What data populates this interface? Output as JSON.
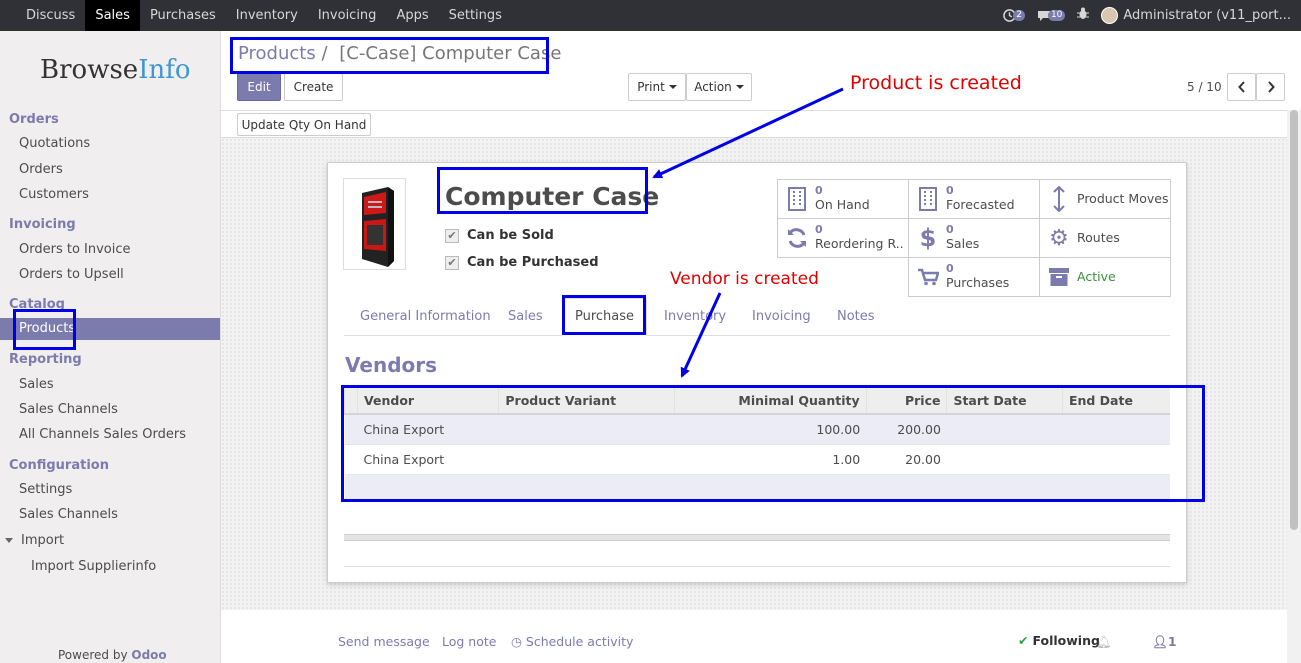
{
  "topbar": {
    "menu": [
      "Discuss",
      "Sales",
      "Purchases",
      "Inventory",
      "Invoicing",
      "Apps",
      "Settings"
    ],
    "active": "Sales",
    "conversation_count": "2",
    "activity_count": "10",
    "user": "Administrator (v11_port..."
  },
  "sidebar": {
    "logo_browse": "Browse",
    "logo_info": "Info",
    "sections": [
      {
        "title": "Orders",
        "items": [
          "Quotations",
          "Orders",
          "Customers"
        ]
      },
      {
        "title": "Invoicing",
        "items": [
          "Orders to Invoice",
          "Orders to Upsell"
        ]
      },
      {
        "title": "Catalog",
        "items": [
          "Products"
        ]
      },
      {
        "title": "Reporting",
        "items": [
          "Sales",
          "Sales Channels",
          "All Channels Sales Orders"
        ]
      },
      {
        "title": "Configuration",
        "items": [
          "Settings",
          "Sales Channels",
          "Import",
          "Import Supplierinfo"
        ]
      }
    ],
    "powered_by": "Powered by",
    "powered_brand": "Odoo"
  },
  "breadcrumb": {
    "parent": "Products",
    "separator": "/",
    "current": "[C-Case] Computer Case"
  },
  "buttons": {
    "edit": "Edit",
    "create": "Create",
    "print": "Print",
    "action": "Action",
    "update_qty": "Update Qty On Hand"
  },
  "pager": {
    "value": "5 / 10"
  },
  "product": {
    "name": "Computer Case",
    "can_be_sold": "Can be Sold",
    "can_be_purchased": "Can be Purchased"
  },
  "smart_buttons": [
    {
      "value": "0",
      "label": "On Hand",
      "icon": "building-icon"
    },
    {
      "value": "0",
      "label": "Forecasted",
      "icon": "building-icon"
    },
    {
      "value": "",
      "label": "Product Moves",
      "icon": "arrows-vertical-icon"
    },
    {
      "value": "0",
      "label": "Reordering R...",
      "icon": "refresh-icon"
    },
    {
      "value": "0",
      "label": "Sales",
      "icon": "dollar-icon"
    },
    {
      "value": "",
      "label": "Routes",
      "icon": "cogs-icon"
    },
    {
      "value": "0",
      "label": "Purchases",
      "icon": "shopping-cart-icon"
    },
    {
      "value": "",
      "label": "Active",
      "icon": "archive-icon"
    }
  ],
  "tabs": [
    "General Information",
    "Sales",
    "Purchase",
    "Inventory",
    "Invoicing",
    "Notes"
  ],
  "active_tab": "Purchase",
  "vendors": {
    "title": "Vendors",
    "columns": [
      "Vendor",
      "Product Variant",
      "Minimal Quantity",
      "Price",
      "Start Date",
      "End Date"
    ],
    "rows": [
      [
        "China Export",
        "",
        "100.00",
        "200.00",
        "",
        ""
      ],
      [
        "China Export",
        "",
        "1.00",
        "20.00",
        "",
        ""
      ]
    ]
  },
  "annotations": {
    "product_created": "Product is created",
    "vendor_created": "Vendor is created"
  },
  "chatter": {
    "send_message": "Send message",
    "log_note": "Log note",
    "schedule": "Schedule activity",
    "following": "Following",
    "followers": "1"
  },
  "colors": {
    "brand": "#7c7bad",
    "topbar": "#2f3136",
    "annotation_box": "#0000e6",
    "annotation_text": "#e00000"
  }
}
